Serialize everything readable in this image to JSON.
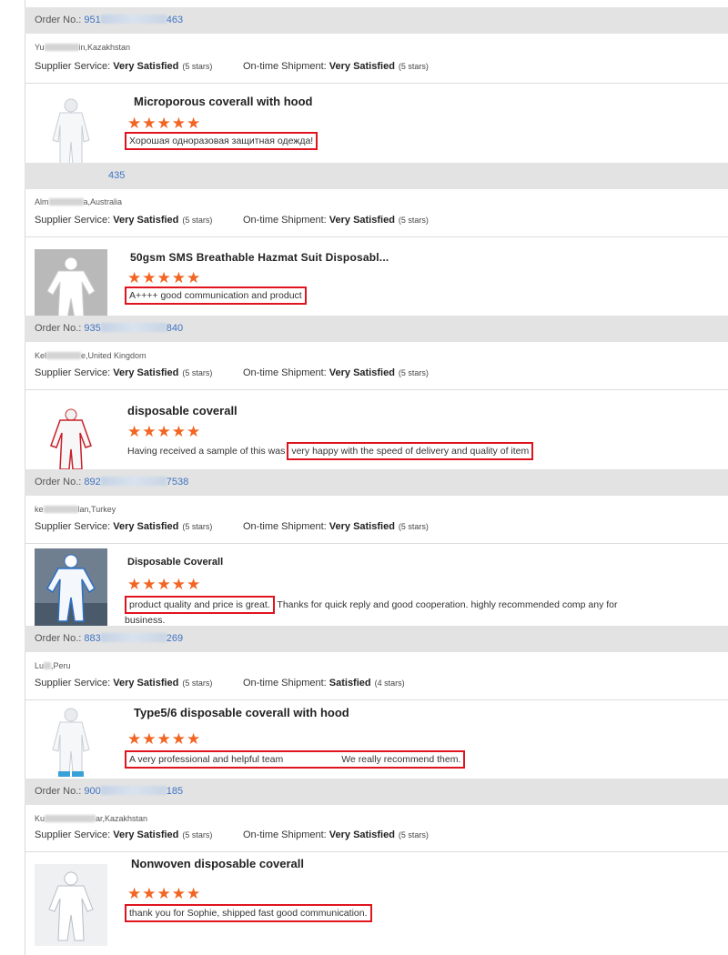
{
  "labels": {
    "order_no": "Order No.:",
    "supplier_service": "Supplier Service:",
    "ontime_shipment": "On-time Shipment:"
  },
  "orders": [
    {
      "order_start": "951",
      "order_end": "463",
      "buyer_start": "Yu",
      "buyer_end": "in,Kazakhstan",
      "supplier_rating": "Very Satisfied",
      "supplier_stars": "(5 stars)",
      "shipment_rating": "Very Satisfied",
      "shipment_stars": "(5 stars)",
      "product_title": "Microporous coverall with hood",
      "review_highlight": "Хорошая одноразовая защитная одежда!"
    },
    {
      "order_start": "",
      "order_end": "435",
      "buyer_start": "Alm",
      "buyer_end": "a,Australia",
      "supplier_rating": "Very Satisfied",
      "supplier_stars": "(5 stars)",
      "shipment_rating": "Very Satisfied",
      "shipment_stars": "(5 stars)",
      "product_title": "50gsm SMS Breathable Hazmat Suit Disposabl...",
      "review_highlight": "A++++ good communication and product"
    },
    {
      "order_start": "935",
      "order_end": "840",
      "buyer_start": "Kel",
      "buyer_end": "e,United Kingdom",
      "supplier_rating": "Very Satisfied",
      "supplier_stars": "(5 stars)",
      "shipment_rating": "Very Satisfied",
      "shipment_stars": "(5 stars)",
      "product_title": "disposable coverall",
      "review_prefix": "Having received a sample of this was",
      "review_highlight": "very happy with the speed of delivery and quality of item"
    },
    {
      "order_start": "892",
      "order_end": "7538",
      "buyer_start": "ke",
      "buyer_end": "lan,Turkey",
      "supplier_rating": "Very Satisfied",
      "supplier_stars": "(5 stars)",
      "shipment_rating": "Very Satisfied",
      "shipment_stars": "(5 stars)",
      "product_title": "Disposable Coverall",
      "review_highlight": "product quality and price is great.",
      "review_suffix": " Thanks for quick reply and good cooperation. highly recommended comp any for business."
    },
    {
      "order_start": "883",
      "order_end": "269",
      "buyer_start": "Lu",
      "buyer_end": ",Peru",
      "supplier_rating": "Very Satisfied",
      "supplier_stars": "(5 stars)",
      "shipment_rating": "Satisfied",
      "shipment_stars": "(4 stars)",
      "product_title": "Type5/6 disposable coverall with hood",
      "review_highlight_a": "A very professional and helpful team",
      "review_highlight_b": "We really recommend them."
    },
    {
      "order_start": "900",
      "order_end": "185",
      "buyer_start": "Ku",
      "buyer_end": "ar,Kazakhstan",
      "supplier_rating": "Very Satisfied",
      "supplier_stars": "(5 stars)",
      "shipment_rating": "Very Satisfied",
      "shipment_stars": "(5 stars)",
      "product_title": "Nonwoven disposable coverall",
      "review_highlight": "thank you for Sophie, shipped fast good communication."
    }
  ],
  "stars_glyph": "★★★★★",
  "colors": {
    "star": "#f26522",
    "highlight_border": "#e0141e",
    "order_link": "#3d73c4",
    "bar_bg": "#e3e3e3"
  },
  "icons": {
    "star": "star-icon",
    "product": "coverall-photo"
  }
}
